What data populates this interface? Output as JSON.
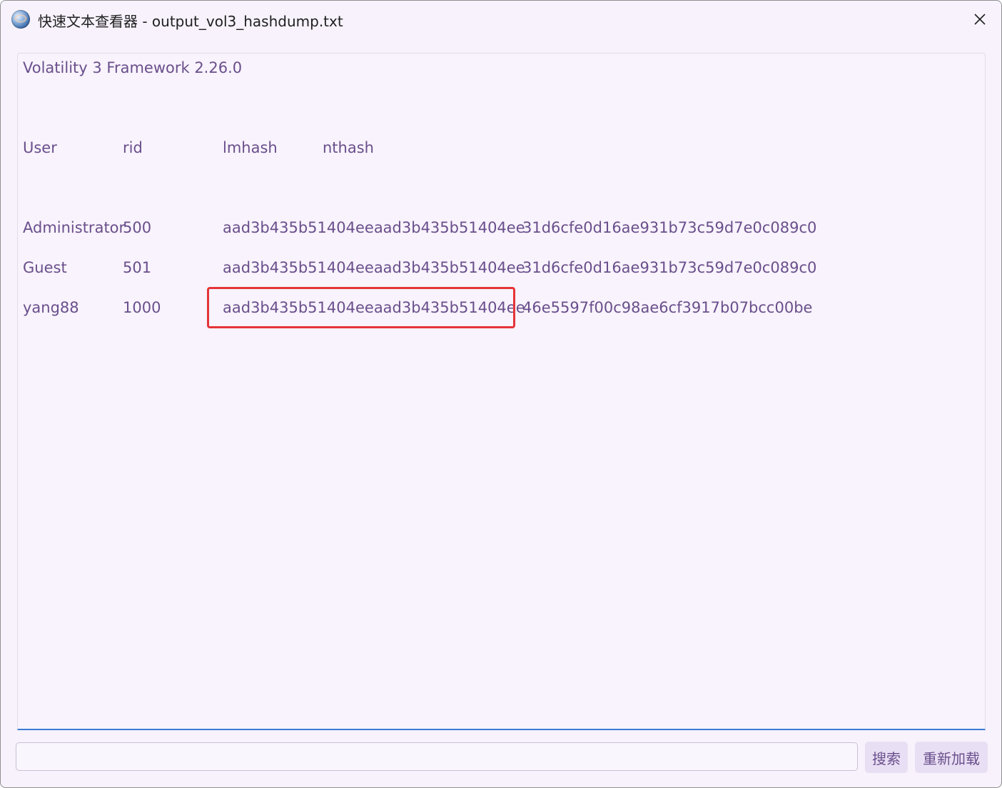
{
  "window": {
    "title": "快速文本查看器 - output_vol3_hashdump.txt",
    "icon": "app-globe-icon",
    "close_icon": "close-icon"
  },
  "content": {
    "header_line": "Volatility 3 Framework 2.26.0",
    "columns": [
      "User",
      "rid",
      "lmhash",
      "nthash"
    ],
    "rows": [
      {
        "user": "Administrator",
        "rid": "500",
        "lmhash": "aad3b435b51404eeaad3b435b51404ee",
        "nthash": "31d6cfe0d16ae931b73c59d7e0c089c0"
      },
      {
        "user": "Guest",
        "rid": "501",
        "lmhash": "aad3b435b51404eeaad3b435b51404ee",
        "nthash": "31d6cfe0d16ae931b73c59d7e0c089c0"
      },
      {
        "user": "yang88",
        "rid": "1000",
        "lmhash": "aad3b435b51404eeaad3b435b51404ee",
        "nthash": "46e5597f00c98ae6cf3917b07bcc00be"
      }
    ],
    "highlighted_cell": "rows.2.lmhash",
    "highlight_color": "#e53438",
    "text_color": "#6a4f8c"
  },
  "footer": {
    "search_value": "",
    "search_button": "搜索",
    "reload_button": "重新加载",
    "accent_color": "#3a7bd5"
  }
}
